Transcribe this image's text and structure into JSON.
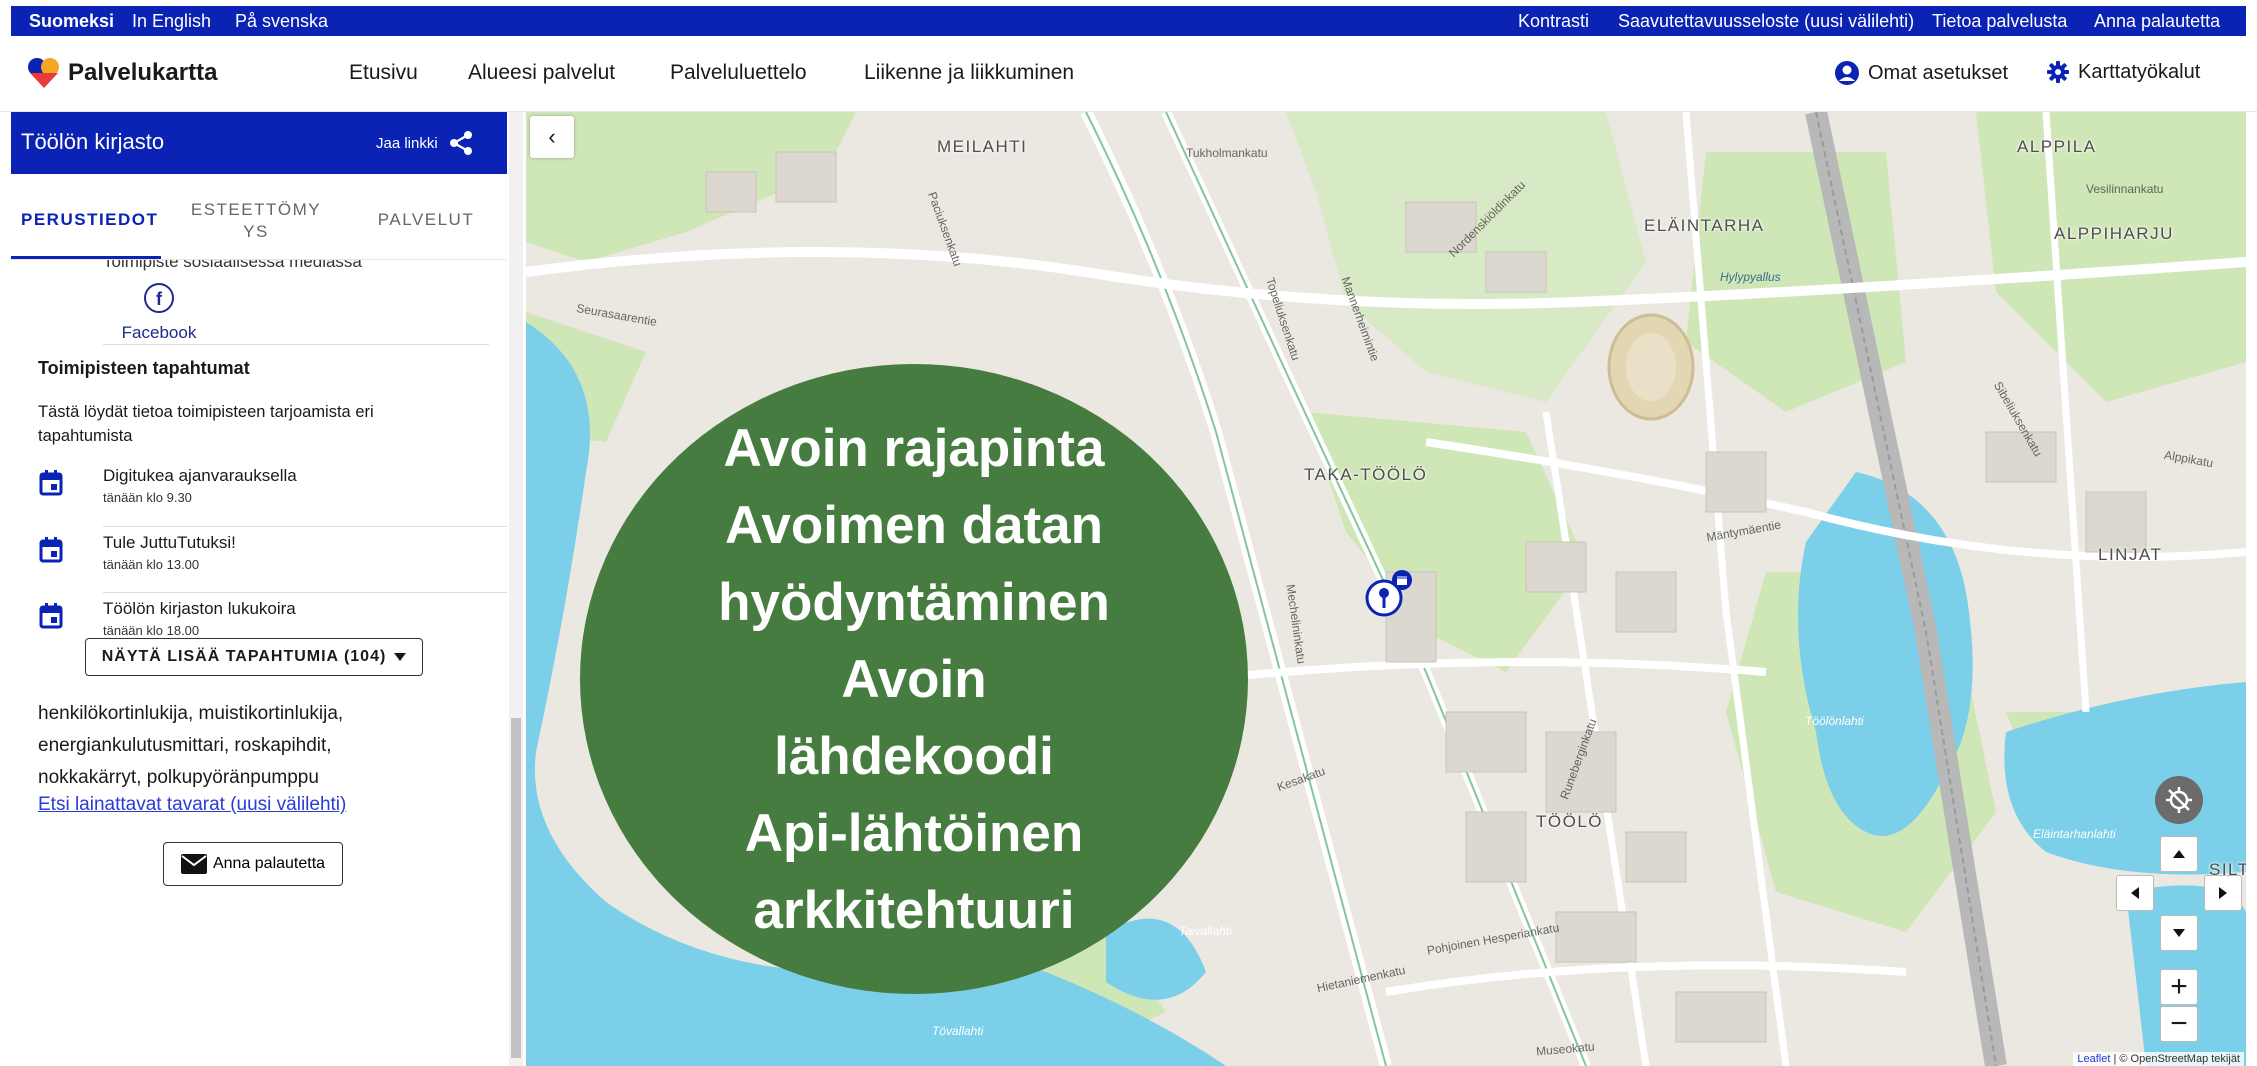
{
  "top_bar": {
    "languages": [
      "Suomeksi",
      "In English",
      "På svenska"
    ],
    "links": [
      "Kontrasti",
      "Saavutettavuusseloste (uusi välilehti)",
      "Tietoa palvelusta",
      "Anna palautetta"
    ]
  },
  "nav": {
    "logo": "Palvelukartta",
    "links": [
      "Etusivu",
      "Alueesi palvelut",
      "Palveluluettelo",
      "Liikenne ja liikkuminen"
    ],
    "settings": "Omat asetukset",
    "map_tools": "Karttatyökalut"
  },
  "panel": {
    "title": "Töölön kirjasto",
    "share": "Jaa linkki",
    "tabs": [
      "PERUSTIEDOT",
      "ESTEETTÖMY YS",
      "PALVELUT"
    ],
    "social_heading": "Toimipiste sosiaalisessa mediassa",
    "facebook": "Facebook",
    "events_heading": "Toimipisteen tapahtumat",
    "events_intro": "Tästä löydät tietoa toimipisteen tarjoamista eri tapahtumista",
    "events": [
      {
        "title": "Digitukea ajanvarauksella",
        "time": "tänään klo 9.30"
      },
      {
        "title": "Tule JuttuTutuksi!",
        "time": "tänään klo 13.00"
      },
      {
        "title": "Töölön kirjaston lukukoira",
        "time": "tänään klo 18.00"
      }
    ],
    "more_events": "NÄYTÄ LISÄÄ TAPAHTUMIA (104)",
    "equipment": "henkilökortinlukija, muistikortinlukija, energiankulutusmittari, roskapihdit, nokkakärryt, polkupyöränpumppu",
    "loan_link": "Etsi lainattavat tavarat (uusi välilehti)",
    "feedback": "Anna palautetta"
  },
  "map": {
    "overlay_lines": [
      "Avoin rajapinta",
      "Avoimen datan",
      "hyödyntäminen",
      "Avoin",
      "lähdekoodi",
      "Api-lähtöinen",
      "arkkitehtuuri"
    ],
    "places": [
      "MEILAHTI",
      "ELÄINTARHA",
      "ALPPILA",
      "ALPPIHARJU",
      "TAKA-TÖÖLÖ",
      "LINJAT",
      "TÖÖLÖ",
      "SILT"
    ],
    "water_labels": [
      "Töölönlahti",
      "Eläintarhanlahti",
      "Taivallahti",
      "Tövallahti",
      "Hylypyallus"
    ],
    "streets": [
      "Tukholmankatu",
      "Paciuksenkatu",
      "Seurasaarentie",
      "Mannerheimintie",
      "Topeliuksenkatu",
      "Mechelininkatu",
      "Runeberginkatu",
      "Mäntymäentie",
      "Nordenskiöldinkatu",
      "Pohjoinen Hesperiankatu",
      "Hietaniemenkatu",
      "Museokatu",
      "Kesakatu",
      "Sibeliuksenkatu",
      "Vesilinnankatu",
      "Alppikatu"
    ],
    "attribution_leaflet": "Leaflet",
    "attribution_osm": "| © OpenStreetMap tekijät",
    "colors": {
      "water": "#7ccfe8",
      "park": "#cfe6b6",
      "land": "#ebe8e1",
      "overlay": "#467c40",
      "primary": "#0a23b4"
    }
  }
}
